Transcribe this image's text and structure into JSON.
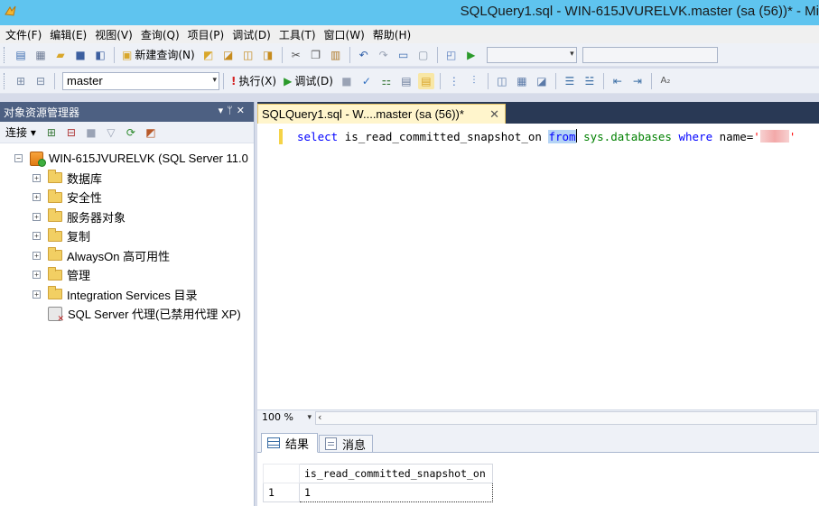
{
  "window": {
    "title": "SQLQuery1.sql - WIN-615JVURELVK.master (sa (56))* - Mi"
  },
  "menu": [
    "文件(F)",
    "编辑(E)",
    "视图(V)",
    "查询(Q)",
    "项目(P)",
    "调试(D)",
    "工具(T)",
    "窗口(W)",
    "帮助(H)"
  ],
  "toolbar1": {
    "new_query_label": "新建查询(N)"
  },
  "toolbar2": {
    "database": "master",
    "execute_label": "执行(X)",
    "debug_label": "调试(D)"
  },
  "object_explorer": {
    "title": "对象资源管理器",
    "connect_label": "连接",
    "server": "WIN-615JVURELVK (SQL Server 11.0",
    "nodes": [
      "数据库",
      "安全性",
      "服务器对象",
      "复制",
      "AlwaysOn 高可用性",
      "管理",
      "Integration Services 目录"
    ],
    "agent": "SQL Server 代理(已禁用代理 XP)"
  },
  "document": {
    "tab_label": "SQLQuery1.sql - W....master (sa (56))*",
    "query": {
      "select": "select",
      "column": "is_read_committed_snapshot_on",
      "from": "from",
      "table": "sys.databases",
      "where": "where",
      "field": "name",
      "op": "=",
      "quote_open": "'",
      "quote_close": "'"
    },
    "zoom": "100 %"
  },
  "results": {
    "tab_results": "结果",
    "tab_messages": "消息",
    "column": "is_read_committed_snapshot_on",
    "rows": [
      {
        "num": "1",
        "value": "1"
      }
    ]
  }
}
